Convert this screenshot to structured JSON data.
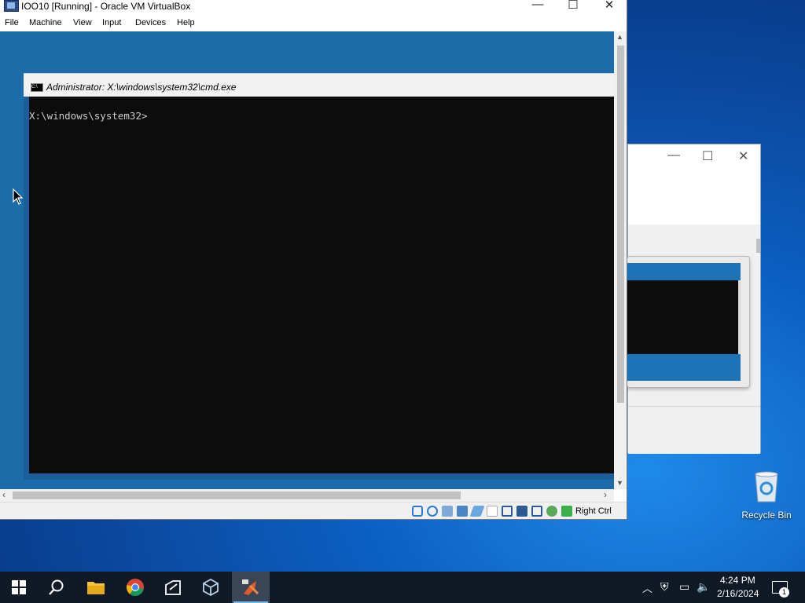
{
  "virtualbox": {
    "title": "IOO10 [Running] - Oracle VM VirtualBox",
    "menu": [
      "File",
      "Machine",
      "View",
      "Input",
      "Devices",
      "Help"
    ],
    "host_key": "Right Ctrl"
  },
  "cmd": {
    "title": "Administrator: X:\\windows\\system32\\cmd.exe",
    "icon_text": "C:\\",
    "prompt": "X:\\windows\\system32>"
  },
  "desktop": {
    "recycle_bin_label": "Recycle Bin"
  },
  "taskbar": {
    "time": "4:24 PM",
    "date": "2/16/2024",
    "notification_count": "1",
    "apps": [
      "start-icon",
      "search-icon",
      "file-explorer-icon",
      "chrome-icon",
      "app-icon",
      "virtualbox-icon",
      "kali-vm-icon"
    ]
  },
  "colors": {
    "vm_background": "#1b6ca8",
    "console_background": "#0c0c0c",
    "console_text": "#cccccc",
    "taskbar": "#101a27"
  }
}
